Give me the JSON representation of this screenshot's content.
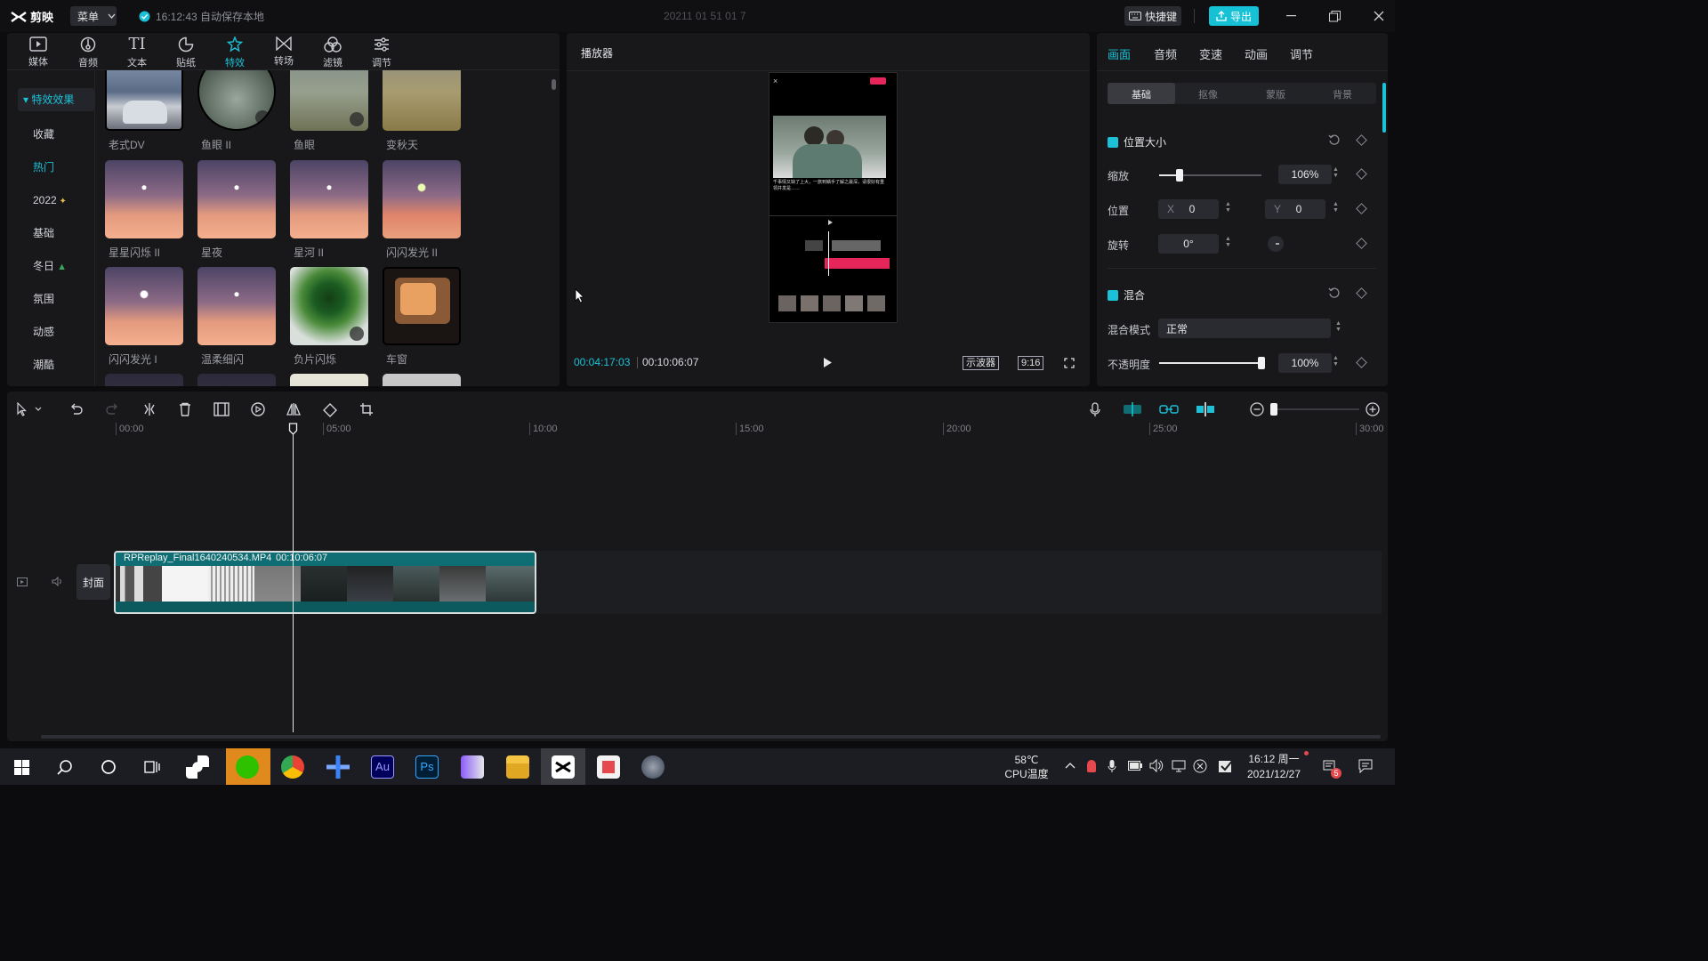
{
  "titlebar": {
    "app_name": "剪映",
    "menu_label": "菜单",
    "autosave_text": "16:12:43 自动保存本地",
    "project_title": "20211 01 51 01 7",
    "shortcut_label": "快捷键",
    "export_label": "导出"
  },
  "media_toolbar": [
    {
      "label": "媒体",
      "icon": "media-icon"
    },
    {
      "label": "音频",
      "icon": "audio-icon"
    },
    {
      "label": "文本",
      "icon": "text-icon"
    },
    {
      "label": "贴纸",
      "icon": "sticker-icon"
    },
    {
      "label": "特效",
      "icon": "effects-icon",
      "active": true
    },
    {
      "label": "转场",
      "icon": "transition-icon"
    },
    {
      "label": "滤镜",
      "icon": "filter-icon"
    },
    {
      "label": "调节",
      "icon": "adjust-icon"
    }
  ],
  "categories": {
    "header": "特效效果",
    "items": [
      "收藏",
      "热门",
      "2022",
      "基础",
      "冬日",
      "氛围",
      "动感",
      "潮酷"
    ],
    "active": "热门"
  },
  "effects": [
    {
      "label": "老式DV"
    },
    {
      "label": "鱼眼 II"
    },
    {
      "label": "鱼眼"
    },
    {
      "label": "变秋天"
    },
    {
      "label": "星星闪烁 II"
    },
    {
      "label": "星夜"
    },
    {
      "label": "星河 II"
    },
    {
      "label": "闪闪发光 II"
    },
    {
      "label": "闪闪发光 I"
    },
    {
      "label": "温柔细闪"
    },
    {
      "label": "负片闪烁"
    },
    {
      "label": "车窗"
    }
  ],
  "player": {
    "title": "播放器",
    "current_time": "00:04:17:03",
    "total_time": "00:10:06:07",
    "scope_label": "示波器",
    "ratio_label": "9:16",
    "preview_caption": "千事情又缺了上大，一旅到鳞手了解之最深，请很好有重领并发是……"
  },
  "props": {
    "tabs": [
      "画面",
      "音频",
      "变速",
      "动画",
      "调节"
    ],
    "subtabs": [
      "基础",
      "抠像",
      "蒙版",
      "背景"
    ],
    "section_position": "位置大小",
    "scale_label": "缩放",
    "scale_value": "106%",
    "scale_fraction": 0.2,
    "position_label": "位置",
    "pos_x_label": "X",
    "pos_x": "0",
    "pos_y_label": "Y",
    "pos_y": "0",
    "rotate_label": "旋转",
    "rotate_value": "0°",
    "section_blend": "混合",
    "blend_mode_label": "混合模式",
    "blend_mode_value": "正常",
    "opacity_label": "不透明度",
    "opacity_value": "100%",
    "opacity_fraction": 1.0
  },
  "timeline": {
    "ruler": [
      "00:00",
      "05:00",
      "10:00",
      "15:00",
      "20:00",
      "25:00",
      "30:00"
    ],
    "cover_label": "封面",
    "clip_name": "RPReplay_Final1640240534.MP4",
    "clip_duration": "00:10:06:07"
  },
  "taskbar": {
    "cpu_temp": "58℃",
    "cpu_label": "CPU温度",
    "time": "16:12 周一",
    "date": "2021/12/27",
    "notification_count": "5"
  },
  "colors": {
    "accent": "#1bc1d6",
    "panel": "#18181b",
    "clip": "#0f6e73"
  }
}
